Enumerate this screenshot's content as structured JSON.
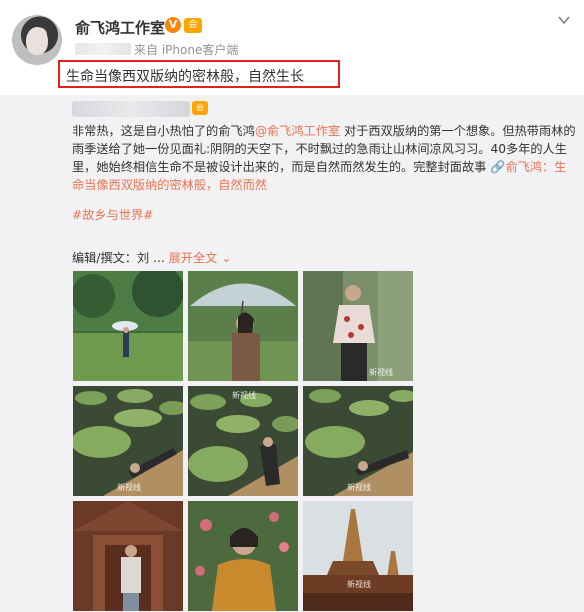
{
  "post": {
    "author": "俞飞鸿工作室",
    "verified_icon": "V",
    "member_icon": "会",
    "source": "来自 iPhone客户端",
    "text": "生命当像西双版纳的密林般，自然生长",
    "highlight_color": "#e0241b"
  },
  "repost": {
    "body_1": "非常热，这是自小热怕了的俞飞鸿",
    "mention_1": "@俞飞鸿工作室",
    "body_2": " 对于西双版纳的第一个想象。但热带雨林的雨季送给了她一份见面礼:阴阴的天空下，不时飘过的急雨让山林间凉风习习。40多年的人生里，她始终相信生命不是被设计出来的，而是自然而然发生的。完整封面故事 ",
    "link_text": "俞飞鸿：生命当像西双版纳的密林般，自然而然",
    "topic": "#故乡与世界#",
    "editor": "编辑/撰文：刘 ...",
    "expand": "展开全文",
    "link_color": "#eb7350"
  },
  "photos": {
    "watermark": "新视线",
    "scenes": [
      "umbrella-lawn-wide",
      "umbrella-portrait",
      "red-jacket-foliage",
      "lily-pads-dock-1",
      "lily-pads-dock-2",
      "lily-pads-dock-3",
      "temple-door-portrait",
      "yellow-sweater-flowers",
      "pagoda-spires"
    ]
  }
}
